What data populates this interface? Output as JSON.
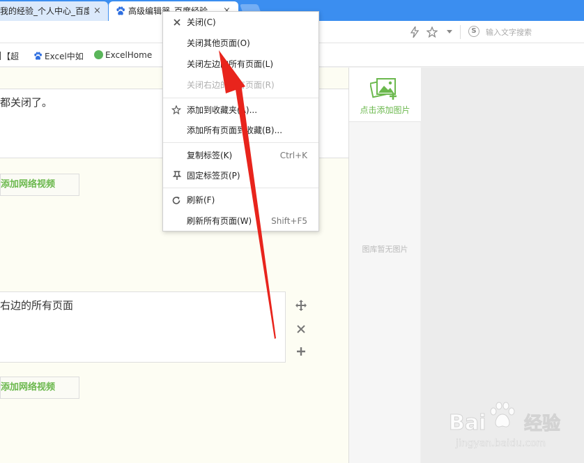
{
  "tabs": [
    {
      "title": "我的经验_个人中心_百度",
      "close": "×"
    },
    {
      "title": "高级编辑器_百度经验",
      "close": "×"
    }
  ],
  "search": {
    "placeholder": "输入文字搜索",
    "s_badge": "S"
  },
  "bookmarks": [
    "【超",
    "Excel中如",
    "ExcelHome"
  ],
  "editor": {
    "block1_text": "都关闭了。",
    "block2_text": "右边的所有页面",
    "video_button": "添加网络视频"
  },
  "gallery": {
    "add_label": "点击添加图片",
    "empty_label": "图库暂无图片"
  },
  "context_menu": {
    "items": [
      {
        "label": "关闭(C)",
        "shortcut": "",
        "icon": "close-icon"
      },
      {
        "label": "关闭其他页面(O)",
        "shortcut": "",
        "icon": ""
      },
      {
        "label": "关闭左边的所有页面(L)",
        "shortcut": "",
        "icon": ""
      },
      {
        "label": "关闭右边的所有页面(R)",
        "shortcut": "",
        "icon": "",
        "disabled": true
      },
      {
        "label": "添加到收藏夹(A)...",
        "shortcut": "",
        "icon": "star-icon"
      },
      {
        "label": "添加所有页面到收藏(B)...",
        "shortcut": "",
        "icon": ""
      },
      {
        "label": "复制标签(K)",
        "shortcut": "Ctrl+K",
        "icon": ""
      },
      {
        "label": "固定标签页(P)",
        "shortcut": "",
        "icon": "pin-icon"
      },
      {
        "label": "刷新(F)",
        "shortcut": "",
        "icon": "refresh-icon"
      },
      {
        "label": "刷新所有页面(W)",
        "shortcut": "Shift+F5",
        "icon": ""
      }
    ]
  },
  "watermark": {
    "brand": "Bai",
    "brand_cn": "经验",
    "url": "jingyan.baidu.com"
  },
  "colors": {
    "tabbar": "#3b8ef0",
    "accent_green": "#6bb84d",
    "arrow_red": "#e8241c"
  }
}
